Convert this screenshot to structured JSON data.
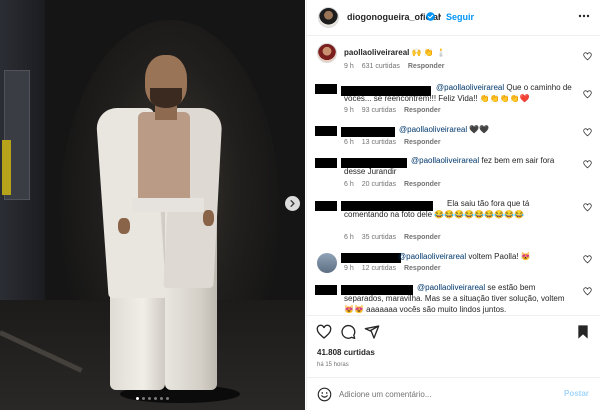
{
  "header": {
    "username": "diogonogueira_oficial",
    "separator": "•",
    "follow_label": "Seguir"
  },
  "carousel": {
    "slide_count": 6,
    "active_index": 0
  },
  "caption_comment": {
    "username": "paollaoliveirareal",
    "text": "🙌 👏 🕯️",
    "age": "9 h",
    "likes": "631 curtidas",
    "reply": "Responder"
  },
  "comments": [
    {
      "text": "@paollaoliveirareal Que o caminho de vocês... se reencontrem!!! Feliz Vida!! 👏👏👏👏❤️",
      "age": "9 h",
      "likes": "93 curtidas",
      "reply": "Responder"
    },
    {
      "text": "@paollaoliveirareal 🖤🖤",
      "age": "6 h",
      "likes": "13 curtidas",
      "reply": "Responder"
    },
    {
      "text": "@paollaoliveirareal fez bem em sair fora desse Jurandir",
      "age": "6 h",
      "likes": "20 curtidas",
      "reply": "Responder"
    },
    {
      "text": "Ela saiu tão fora que tá comentando na foto dele 😂😂😂😂😂😂😂😂😂",
      "age": "6 h",
      "likes": "35 curtidas",
      "reply": "Responder"
    },
    {
      "text": "@paollaoliveirareal voltem Paolla! 😻",
      "age": "9 h",
      "likes": "12 curtidas",
      "reply": "Responder"
    },
    {
      "text": "@paollaoliveirareal se estão bem separados, maravilha. Mas se a situação tiver solução, voltem 😻😻 aaaaaaa vocês são muito lindos juntos.",
      "age": "",
      "likes": "",
      "reply": ""
    }
  ],
  "footer": {
    "likes": "41.808 curtidas",
    "time": "há 15 horas",
    "comment_placeholder": "Adicione um comentário...",
    "post_label": "Postar"
  },
  "colors": {
    "link_blue": "#0095f6",
    "mention_blue": "#00376b",
    "muted": "#737373",
    "post_disabled": "#a3d6fb"
  },
  "icons": {
    "verified": "verified-badge-icon",
    "more": "more-options-icon",
    "heart": "heart-icon",
    "comment": "comment-icon",
    "share": "share-icon",
    "save": "bookmark-icon",
    "next": "chevron-right-icon",
    "emoji": "smiley-icon"
  }
}
